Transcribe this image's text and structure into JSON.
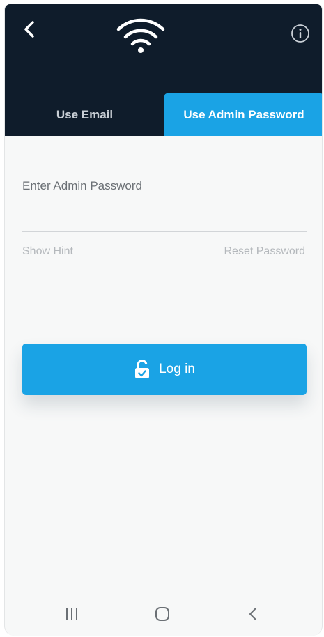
{
  "header": {
    "back_icon": "back-arrow-icon",
    "wifi_icon": "wifi-icon",
    "info_icon": "info-icon"
  },
  "tabs": [
    {
      "label": "Use Email",
      "active": false
    },
    {
      "label": "Use Admin Password",
      "active": true
    }
  ],
  "form": {
    "password_label": "Enter Admin Password",
    "password_value": "",
    "show_hint": "Show Hint",
    "reset_password": "Reset Password"
  },
  "login_button": {
    "label": "Log in",
    "icon": "unlock-icon"
  },
  "system_nav": {
    "recents_icon": "recents-icon",
    "home_icon": "home-icon",
    "back_icon": "back-icon"
  },
  "colors": {
    "header_bg": "#0f1c2b",
    "accent": "#1aa3e5",
    "background": "#f7f8f8"
  }
}
